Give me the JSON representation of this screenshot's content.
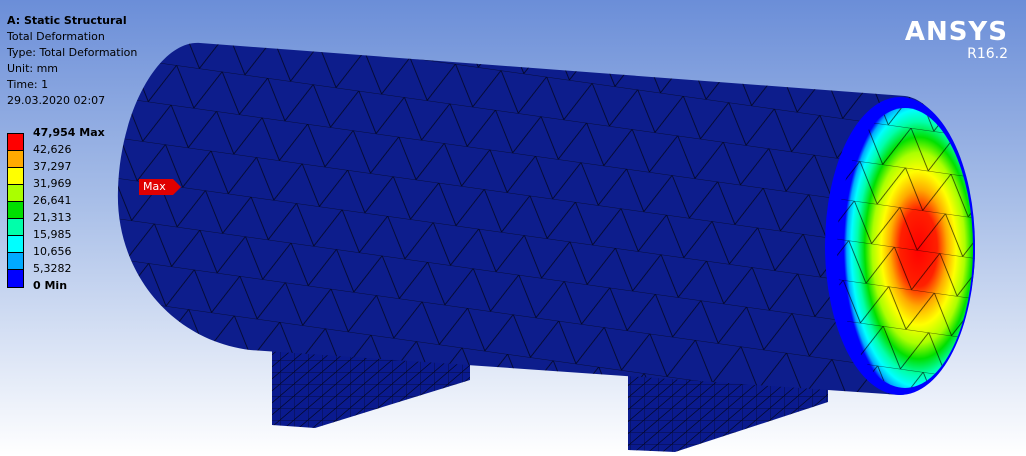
{
  "header": {
    "analysis": "A: Static Structural",
    "result": "Total Deformation",
    "type": "Type: Total Deformation",
    "unit": "Unit: mm",
    "time": "Time: 1",
    "datetime": "29.03.2020 02:07"
  },
  "legend": {
    "max_label": "47,954 Max",
    "min_label": "0 Min",
    "levels": [
      "47,954 Max",
      "42,626",
      "37,297",
      "31,969",
      "26,641",
      "21,313",
      "15,985",
      "10,656",
      "5,3282",
      "0 Min"
    ],
    "colors": [
      "#ff0000",
      "#ffaa00",
      "#ffff00",
      "#aaff00",
      "#00e000",
      "#00ffaa",
      "#00ffff",
      "#00aaff",
      "#0000ff"
    ]
  },
  "probe": {
    "max_tag": "Max"
  },
  "logo": {
    "name": "ANSYS",
    "version": "R16.2"
  }
}
